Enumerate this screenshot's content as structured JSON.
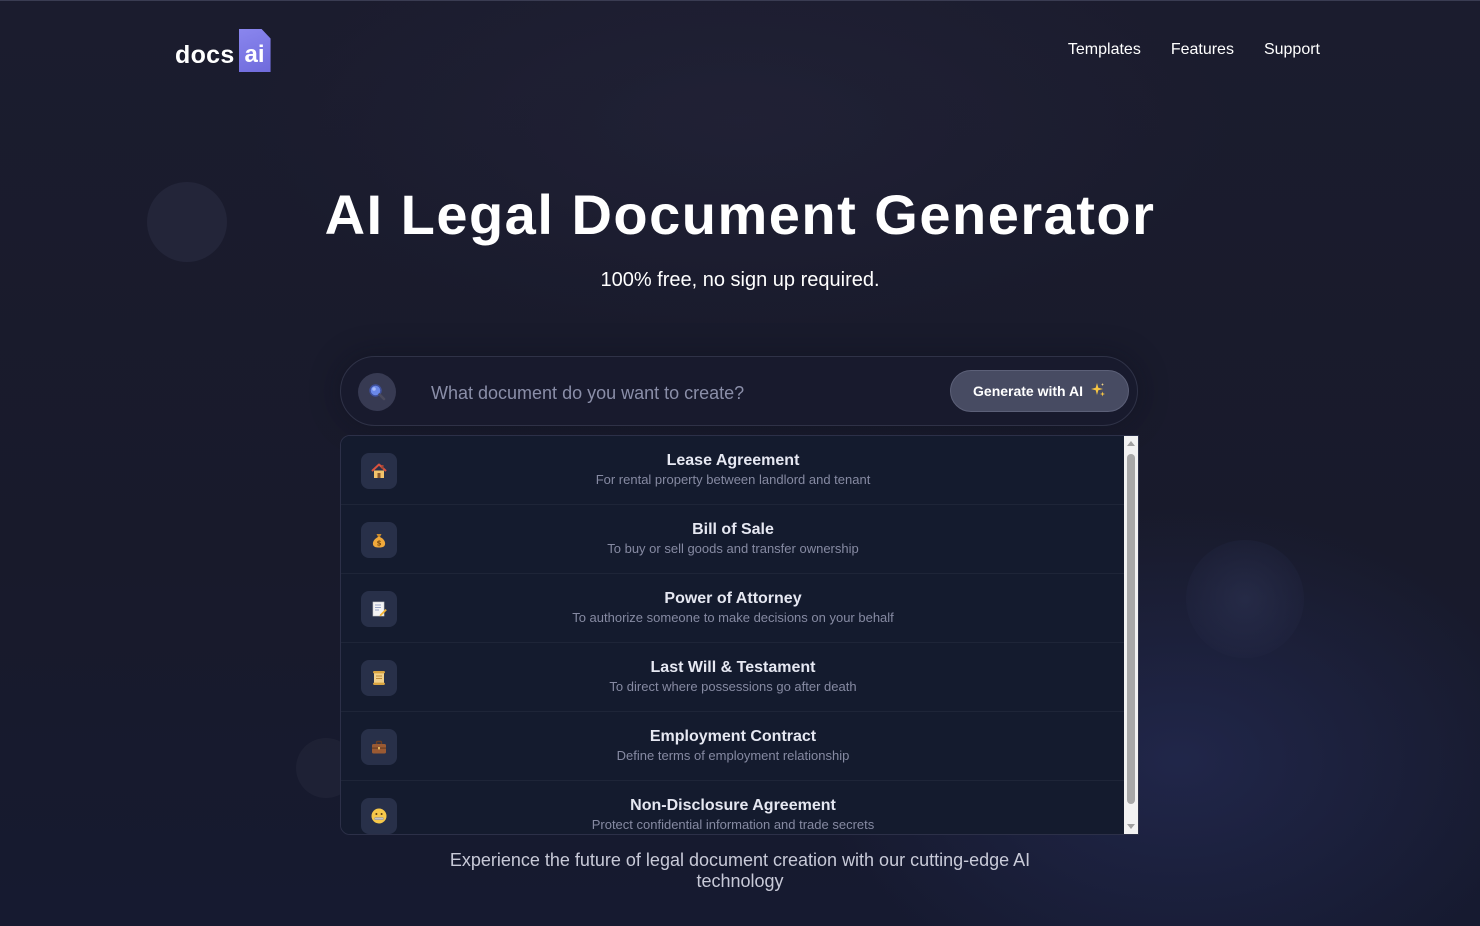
{
  "header": {
    "logo": {
      "word": "docs",
      "badge": "ai",
      "badge_color": "#7b78e8"
    },
    "nav": [
      {
        "label": "Templates"
      },
      {
        "label": "Features"
      },
      {
        "label": "Support"
      }
    ]
  },
  "hero": {
    "title": "AI Legal Document Generator",
    "subtitle": "100% free, no sign up required."
  },
  "search": {
    "icon": "magnifier-icon",
    "placeholder": "What document do you want to create?",
    "value": "",
    "button_label": "Generate with AI",
    "button_icon": "sparkles-icon"
  },
  "suggestions": [
    {
      "title": "Lease Agreement",
      "description": "For rental property between landlord and tenant",
      "icon": "house-icon"
    },
    {
      "title": "Bill of Sale",
      "description": "To buy or sell goods and transfer ownership",
      "icon": "money-bag-icon"
    },
    {
      "title": "Power of Attorney",
      "description": "To authorize someone to make decisions on your behalf",
      "icon": "memo-icon"
    },
    {
      "title": "Last Will & Testament",
      "description": "To direct where possessions go after death",
      "icon": "scroll-icon"
    },
    {
      "title": "Employment Contract",
      "description": "Define terms of employment relationship",
      "icon": "briefcase-icon"
    },
    {
      "title": "Non-Disclosure Agreement",
      "description": "Protect confidential information and trade secrets",
      "icon": "zipper-mouth-icon"
    }
  ],
  "footer": {
    "tagline": "Experience the future of legal document creation with our cutting-edge AI technology"
  },
  "colors": {
    "background": "#191b2c",
    "dropdown": "#141b2e",
    "accent": "#7b78e8",
    "button": "#474b62"
  }
}
